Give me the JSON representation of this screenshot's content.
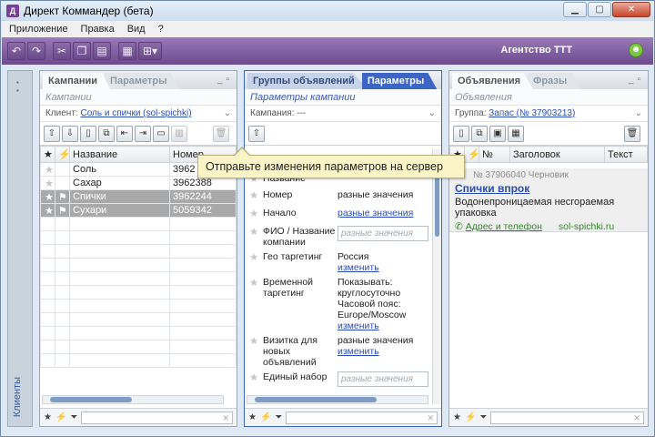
{
  "window": {
    "title": "Директ Коммандер (бета)",
    "app_icon": "app-logo-icon"
  },
  "menu": [
    "Приложение",
    "Правка",
    "Вид",
    "?"
  ],
  "toolbar": {
    "agency": "Агентство ТТТ",
    "icons": [
      "undo-icon",
      "redo-icon",
      "cut-icon",
      "copy-icon",
      "paste-icon",
      "grid-icon",
      "layout-icon"
    ]
  },
  "left_strip": {
    "label": "Клиенты"
  },
  "campaigns_panel": {
    "tabs": [
      "Кампании",
      "Параметры"
    ],
    "subtitle": "Кампании",
    "client_label": "Клиент:",
    "client_value": "Соль и спички (sol-spichki)",
    "columns": [
      "★",
      "⚡",
      "Название",
      "Номер"
    ],
    "rows": [
      {
        "name": "Соль",
        "number": "3962",
        "selected": false
      },
      {
        "name": "Сахар",
        "number": "3962388",
        "selected": false
      },
      {
        "name": "Спички",
        "number": "3962244",
        "selected": true
      },
      {
        "name": "Сухари",
        "number": "5059342",
        "selected": true
      }
    ]
  },
  "params_panel": {
    "tabs": [
      "Группы объявлений",
      "Параметры"
    ],
    "subtitle": "Параметры кампании",
    "campaign_label": "Кампания:",
    "campaign_value": "---",
    "params": [
      {
        "label": "Название",
        "value": "",
        "link": ""
      },
      {
        "label": "Номер",
        "value": "разные значения",
        "link": ""
      },
      {
        "label": "Начало",
        "value": "",
        "link": "разные значения"
      },
      {
        "label": "ФИО / Название компании",
        "input": "разные значения"
      },
      {
        "label": "Гео таргетинг",
        "value": "Россия",
        "link": "изменить"
      },
      {
        "label": "Временной таргетинг",
        "value": "Показывать: круглосуточно Часовой пояс: Europe/Moscow",
        "link": "изменить"
      },
      {
        "label": "Визитка для новых объявлений",
        "value": "разные значения",
        "link": "изменить"
      },
      {
        "label": "Единый набор",
        "input": "разные значения"
      }
    ]
  },
  "ads_panel": {
    "tabs": [
      "Объявления",
      "Фразы"
    ],
    "subtitle": "Объявления",
    "group_label": "Группа:",
    "group_value": "Запас (№ 37903213)",
    "columns": [
      "★",
      "⚡",
      "№",
      "Заголовок",
      "Текст"
    ],
    "ad": {
      "meta": "№ 37906040  Черновик",
      "headline": "Спички впрок",
      "body": "Водонепроницаемая несгораемая упаковка",
      "link1": "Адрес и телефон",
      "domain": "sol-spichki.ru"
    }
  },
  "tooltip": "Отправьте изменения параметров на сервер"
}
